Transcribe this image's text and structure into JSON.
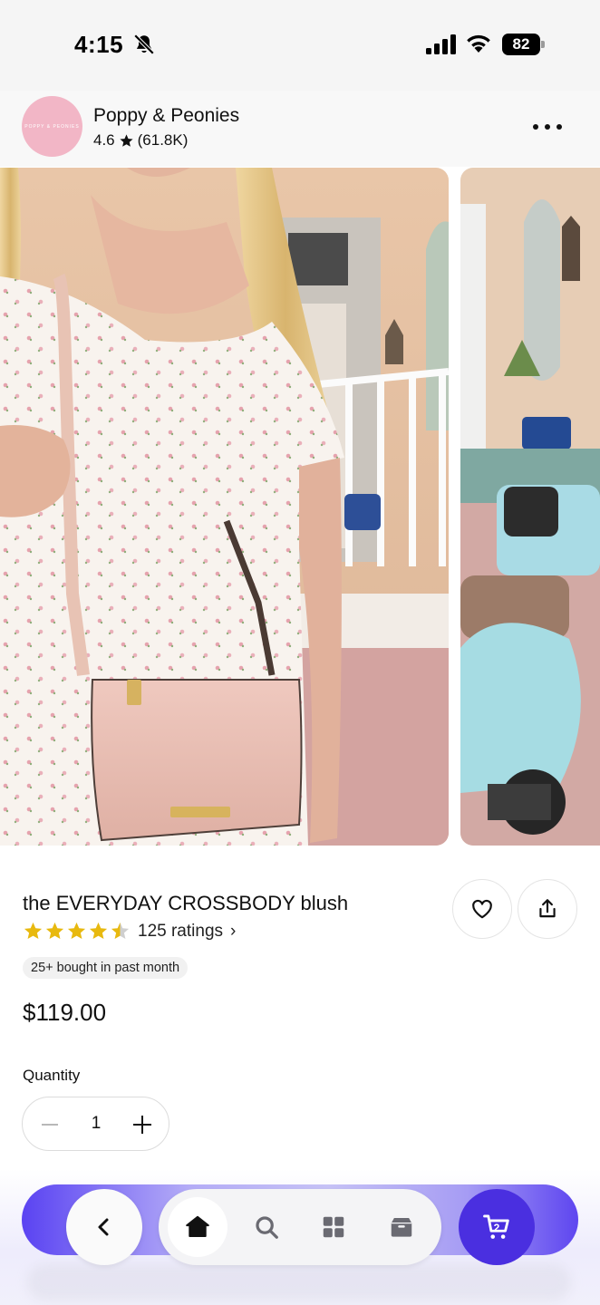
{
  "status_bar": {
    "time": "4:15",
    "battery": "82"
  },
  "shop": {
    "avatar_text": "POPPY & PEONIES",
    "name": "Poppy & Peonies",
    "rating": "4.6",
    "review_count": "(61.8K)"
  },
  "product": {
    "title": "the EVERYDAY CROSSBODY blush",
    "star_rating": 4.5,
    "ratings_text": "125 ratings",
    "bought_badge": "25+ bought in past month",
    "price": "$119.00",
    "quantity_label": "Quantity",
    "quantity": "1"
  },
  "nav": {
    "cart_count": "2"
  },
  "icons": {
    "status": [
      "bell-off-icon",
      "signal-icon",
      "wifi-icon",
      "battery-icon"
    ],
    "header": [
      "star-icon",
      "more-icon"
    ],
    "actions": [
      "heart-icon",
      "share-icon"
    ],
    "nav": [
      "chevron-left-icon",
      "home-icon",
      "search-icon",
      "grid-icon",
      "box-icon",
      "cart-icon"
    ]
  },
  "colors": {
    "accent": "#4a2fe0",
    "star": "#e8b90f"
  }
}
